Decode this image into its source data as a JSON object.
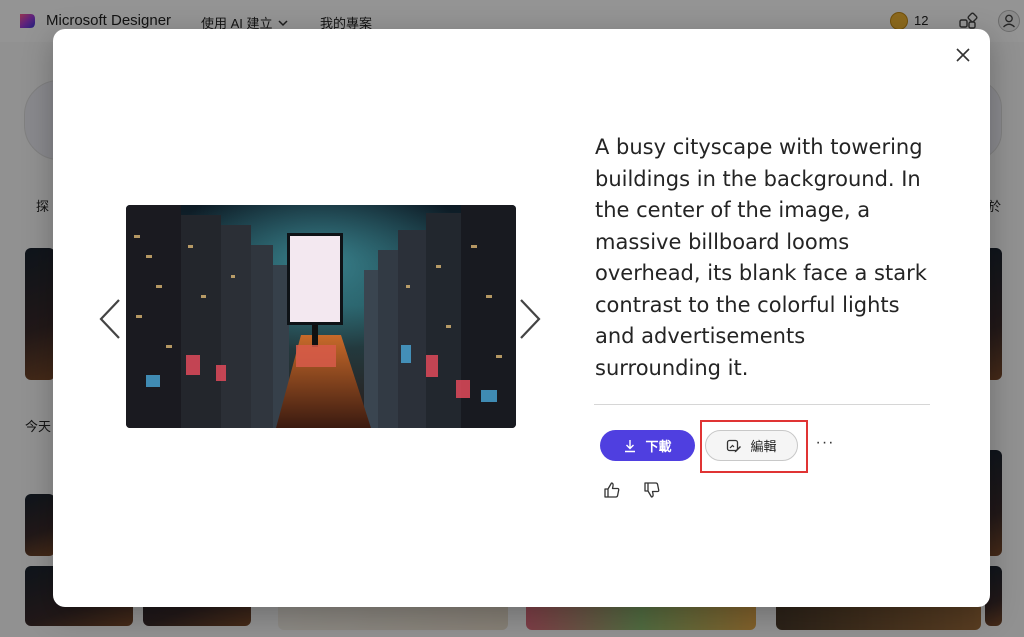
{
  "app": {
    "brand": "Microsoft Designer",
    "nav_create": "使用 AI 建立",
    "nav_projects": "我的專案",
    "coin_count": "12"
  },
  "background": {
    "explore_label": "探",
    "about_label": "於",
    "today_label": "今天"
  },
  "modal": {
    "description": "A busy cityscape with towering buildings in the background. In the center of the image, a massive billboard looms overhead, its blank face a stark contrast to the colorful lights and advertisements surrounding it.",
    "download_label": "下載",
    "edit_label": "編輯",
    "more_label": "···",
    "icons": {
      "close": "close-icon",
      "prev": "chevron-left-icon",
      "next": "chevron-right-icon",
      "download": "download-icon",
      "edit": "edit-image-icon",
      "like": "thumbs-up-icon",
      "dislike": "thumbs-down-icon"
    }
  },
  "colors": {
    "accent": "#4f3fe0",
    "highlight": "#e03434"
  }
}
